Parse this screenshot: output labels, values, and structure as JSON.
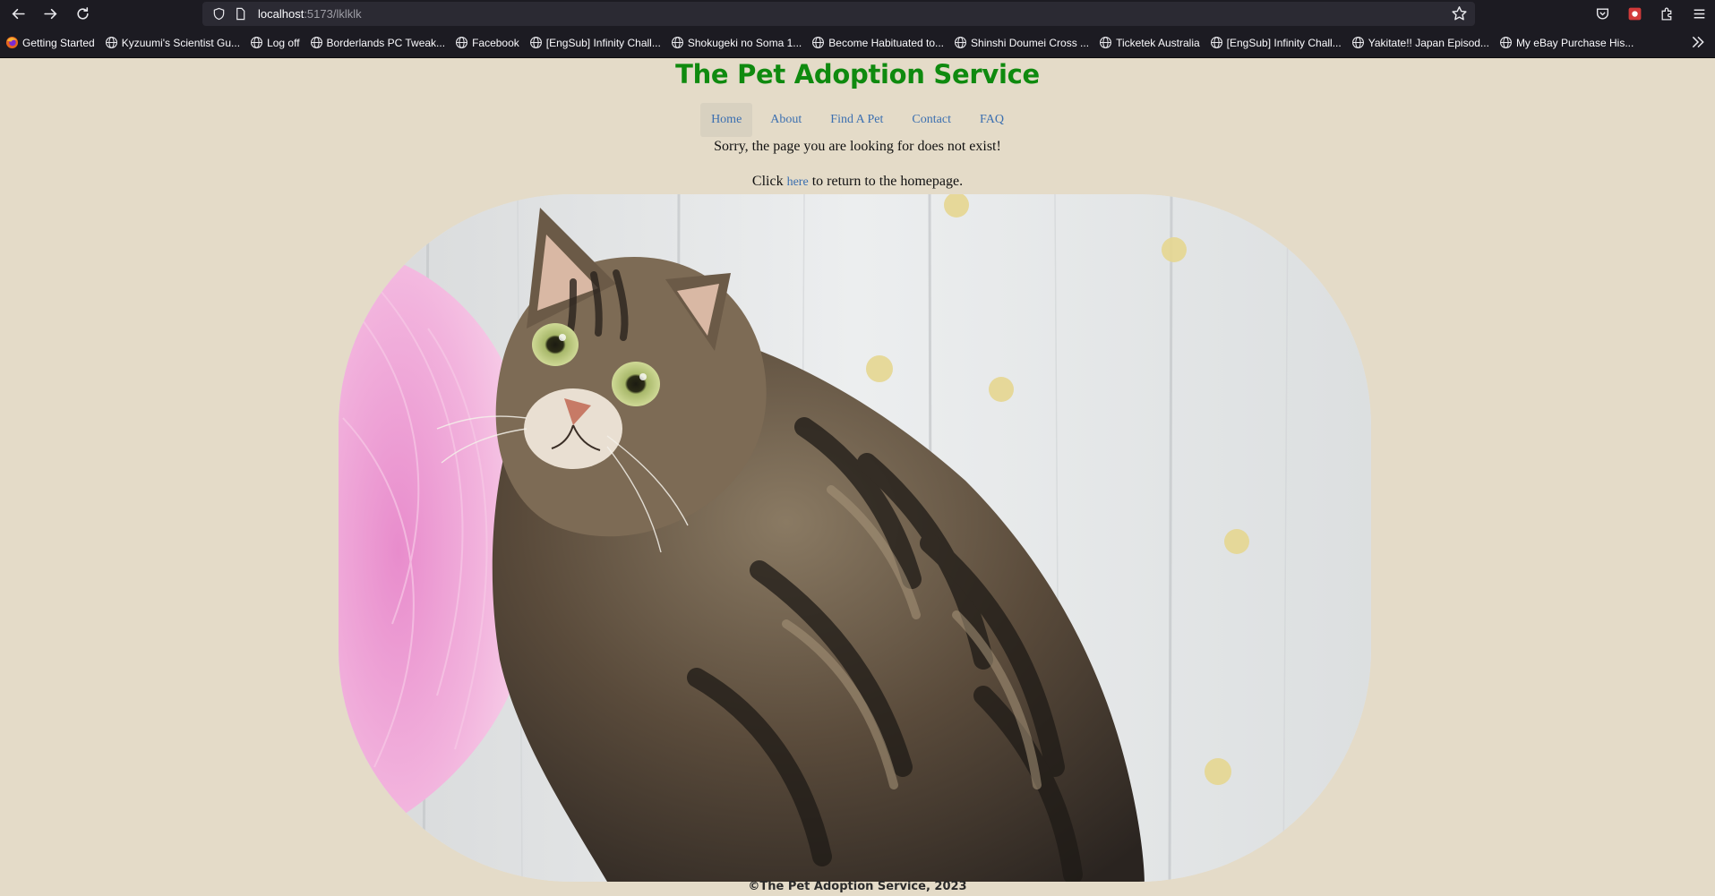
{
  "browser": {
    "url_host": "localhost",
    "url_path": ":5173/lklklk",
    "bookmarks": [
      {
        "label": "Getting Started",
        "icon": "firefox-icon"
      },
      {
        "label": "Kyzuumi's Scientist Gu...",
        "icon": "globe-icon"
      },
      {
        "label": "Log off",
        "icon": "globe-icon"
      },
      {
        "label": "Borderlands PC Tweak...",
        "icon": "globe-icon"
      },
      {
        "label": "Facebook",
        "icon": "globe-icon"
      },
      {
        "label": "[EngSub] Infinity Chall...",
        "icon": "globe-icon"
      },
      {
        "label": "Shokugeki no Soma 1...",
        "icon": "globe-icon"
      },
      {
        "label": "Become Habituated to...",
        "icon": "globe-icon"
      },
      {
        "label": "Shinshi Doumei Cross ...",
        "icon": "globe-icon"
      },
      {
        "label": "Ticketek Australia",
        "icon": "globe-icon"
      },
      {
        "label": "[EngSub] Infinity Chall...",
        "icon": "globe-icon"
      },
      {
        "label": "Yakitate!! Japan Episod...",
        "icon": "globe-icon"
      },
      {
        "label": "My eBay Purchase His...",
        "icon": "globe-icon"
      }
    ]
  },
  "site": {
    "title": "The Pet Adoption Service",
    "nav": [
      {
        "label": "Home",
        "active": true
      },
      {
        "label": "About",
        "active": false
      },
      {
        "label": "Find A Pet",
        "active": false
      },
      {
        "label": "Contact",
        "active": false
      },
      {
        "label": "FAQ",
        "active": false
      }
    ],
    "error_message": "Sorry, the page you are looking for does not exist!",
    "return_prefix": "Click",
    "return_link": "here",
    "return_suffix": "to return to the homepage.",
    "footer": "©The Pet Adoption Service, 2023"
  },
  "colors": {
    "page_background": "#e4dbc8",
    "title_green": "#0f8a0f",
    "link_blue": "#3b6fb0",
    "chrome_dark": "#1c1b22"
  }
}
